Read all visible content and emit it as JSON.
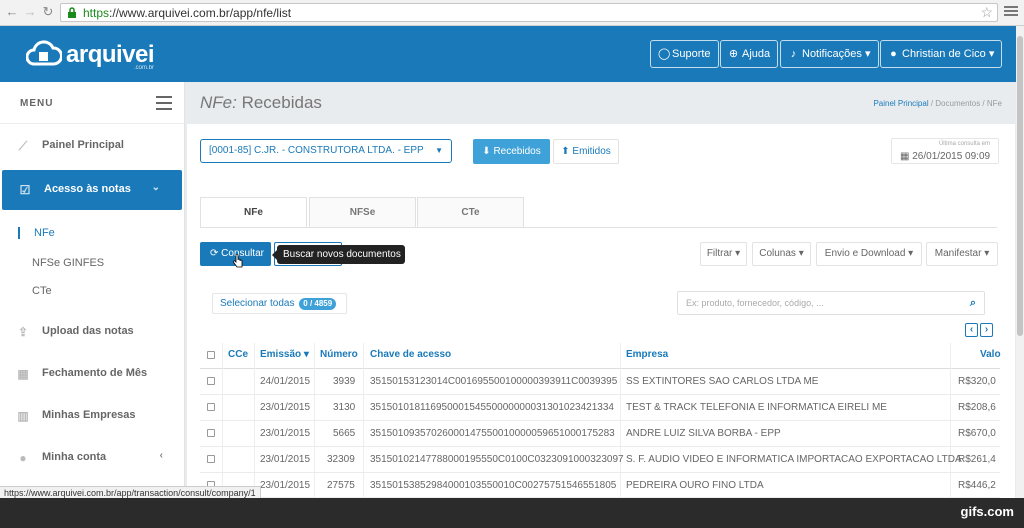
{
  "browser": {
    "url_scheme": "https",
    "url_rest": "://www.arquivei.com.br/app/nfe/list",
    "status_url": "https://www.arquivei.com.br/app/transaction/consult/company/1"
  },
  "header": {
    "logo": "arquivei",
    "logo_sub": ".com.br",
    "buttons": {
      "suporte": "Suporte",
      "ajuda": "Ajuda",
      "notificacoes": "Notificações",
      "user": "Christian de Cico"
    }
  },
  "sidebar": {
    "menu_title": "MENU",
    "items": [
      {
        "label": "Painel Principal",
        "icon": "chart-icon"
      },
      {
        "label": "Acesso às notas",
        "icon": "check-icon"
      },
      {
        "label": "Upload das notas",
        "icon": "upload-icon"
      },
      {
        "label": "Fechamento de Mês",
        "icon": "calendar-icon"
      },
      {
        "label": "Minhas Empresas",
        "icon": "building-icon"
      },
      {
        "label": "Minha conta",
        "icon": "user-icon"
      }
    ],
    "subitems": [
      "NFe",
      "NFSe GINFES",
      "CTe"
    ]
  },
  "page": {
    "title_prefix": "NFe:",
    "title_rest": " Recebidas",
    "breadcrumb": [
      "Painel Principal",
      "Documentos",
      "NFe"
    ]
  },
  "toolbar": {
    "company": "[0001-85] C.JR. - CONSTRUTORA LTDA. - EPP",
    "recebidos": "Recebidos",
    "emitidos": "Emitidos",
    "last_consult_label": "Última consulta em",
    "last_consult_value": "26/01/2015 09:09"
  },
  "tabs": [
    "NFe",
    "NFSe",
    "CTe"
  ],
  "actions": {
    "consultar": "Consultar",
    "tooltip": "Buscar novos documentos",
    "filtrar": "Filtrar",
    "colunas": "Colunas",
    "envio": "Envio e Download",
    "manifestar": "Manifestar"
  },
  "list": {
    "select_all": "Selecionar todas",
    "count_badge": "0 / 4859",
    "search_placeholder": "Ex: produto, fornecedor, código, ..."
  },
  "table": {
    "headers": [
      "CCe",
      "Emissão",
      "Número",
      "Chave de acesso",
      "Empresa",
      "Valo"
    ],
    "rows": [
      {
        "emissao": "24/01/2015",
        "numero": "3939",
        "chave": "35150153123014C001695500100000393911C0039395",
        "empresa": "SS EXTINTORES SAO CARLOS LTDA ME",
        "valor": "R$320,0"
      },
      {
        "emissao": "23/01/2015",
        "numero": "3130",
        "chave": "35150101811695000154550000000031301023421334",
        "empresa": "TEST & TRACK TELEFONIA E INFORMATICA EIRELI ME",
        "valor": "R$208,6"
      },
      {
        "emissao": "23/01/2015",
        "numero": "5665",
        "chave": "35150109357026000147550010000059651000175283",
        "empresa": "ANDRE LUIZ SILVA BORBA - EPP",
        "valor": "R$670,0"
      },
      {
        "emissao": "23/01/2015",
        "numero": "32309",
        "chave": "35150102147788000195550C0100C0323091000323097",
        "empresa": "S. F. AUDIO VIDEO E INFORMATICA IMPORTACAO EXPORTACAO LTDA",
        "valor": "R$261,4"
      },
      {
        "emissao": "23/01/2015",
        "numero": "27575",
        "chave": "35150153852984000103550010C00275751546551805",
        "empresa": "PEDREIRA OURO FINO LTDA",
        "valor": "R$446,2"
      }
    ]
  },
  "watermark": "gifs.com",
  "colors": {
    "primary": "#1a7ab9",
    "accent": "#3ea2d8"
  }
}
